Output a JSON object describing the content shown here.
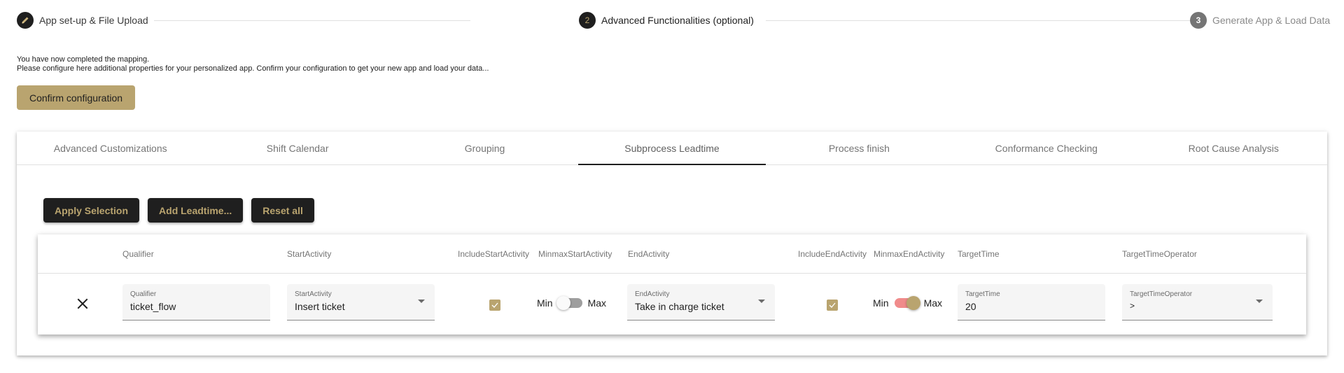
{
  "stepper": {
    "steps": [
      {
        "number": "",
        "icon": "pencil-icon",
        "label": "App set-up & File Upload",
        "state": "done"
      },
      {
        "number": "2",
        "label": "Advanced Functionalities (optional)",
        "state": "active"
      },
      {
        "number": "3",
        "label": "Generate App & Load Data",
        "state": "pending"
      }
    ]
  },
  "intro": {
    "line1": "You have now completed the mapping.",
    "line2": "Please configure here additional properties for your personalized app. Confirm your configuration to get your new app and load your data..."
  },
  "confirm_button": "Confirm configuration",
  "tabs": [
    {
      "label": "Advanced Customizations",
      "active": false
    },
    {
      "label": "Shift Calendar",
      "active": false
    },
    {
      "label": "Grouping",
      "active": false
    },
    {
      "label": "Subprocess Leadtime",
      "active": true
    },
    {
      "label": "Process finish",
      "active": false
    },
    {
      "label": "Conformance Checking",
      "active": false
    },
    {
      "label": "Root Cause Analysis",
      "active": false
    }
  ],
  "actions": {
    "apply": "Apply Selection",
    "add": "Add Leadtime...",
    "reset": "Reset all"
  },
  "table": {
    "columns": [
      "Qualifier",
      "StartActivity",
      "IncludeStartActivity",
      "MinmaxStartActivity",
      "EndActivity",
      "IncludeEndActivity",
      "MinmaxEndActivity",
      "TargetTime",
      "TargetTimeOperator"
    ],
    "rows": [
      {
        "qualifier": {
          "label": "Qualifier",
          "value": "ticket_flow"
        },
        "start_activity": {
          "label": "StartActivity",
          "value": "Insert ticket"
        },
        "include_start_activity": true,
        "minmax_start": {
          "min_label": "Min",
          "max_label": "Max",
          "value": "Min"
        },
        "end_activity": {
          "label": "EndActivity",
          "value": "Take in charge ticket"
        },
        "include_end_activity": true,
        "minmax_end": {
          "min_label": "Min",
          "max_label": "Max",
          "value": "Max"
        },
        "target_time": {
          "label": "TargetTime",
          "value": "20"
        },
        "target_time_operator": {
          "label": "TargetTimeOperator",
          "value": ">"
        }
      }
    ]
  },
  "colors": {
    "accent_gold": "#b9a46f",
    "dark": "#1f1f1f",
    "toggle_on_track": "#f08b8b"
  }
}
